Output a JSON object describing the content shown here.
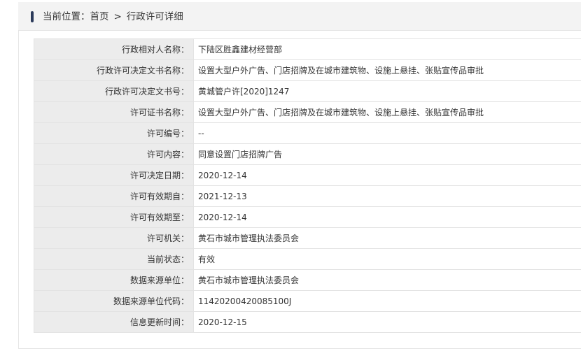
{
  "breadcrumb": {
    "prefix": "当前位置：",
    "home": "首页",
    "separator": ">",
    "current": "行政许可详细"
  },
  "details": [
    {
      "label": "行政相对人名称：",
      "value": "下陆区胜鑫建材经营部"
    },
    {
      "label": "行政许可决定文书名称：",
      "value": "设置大型户外广告、门店招牌及在城市建筑物、设施上悬挂、张贴宣传品审批"
    },
    {
      "label": "行政许可决定文书号：",
      "value": "黄城管户许[2020]1247"
    },
    {
      "label": "许可证书名称：",
      "value": "设置大型户外广告、门店招牌及在城市建筑物、设施上悬挂、张贴宣传品审批"
    },
    {
      "label": "许可编号：",
      "value": "--"
    },
    {
      "label": "许可内容：",
      "value": "同意设置门店招牌广告"
    },
    {
      "label": "许可决定日期：",
      "value": "2020-12-14"
    },
    {
      "label": "许可有效期自：",
      "value": "2021-12-13"
    },
    {
      "label": "许可有效期至：",
      "value": "2020-12-14"
    },
    {
      "label": "许可机关：",
      "value": "黄石市城市管理执法委员会"
    },
    {
      "label": "当前状态：",
      "value": "有效"
    },
    {
      "label": "数据来源单位：",
      "value": "黄石市城市管理执法委员会"
    },
    {
      "label": "数据来源单位代码：",
      "value": "11420200420085100J"
    },
    {
      "label": "信息更新时间：",
      "value": "2020-12-15"
    }
  ]
}
